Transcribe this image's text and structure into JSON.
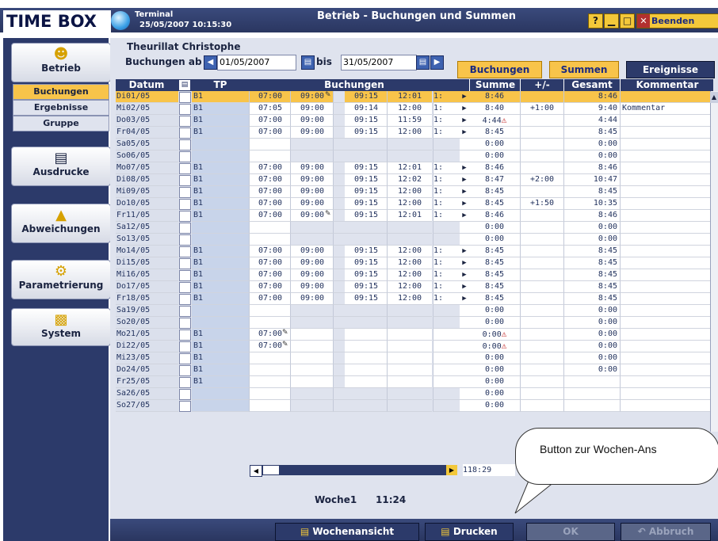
{
  "header": {
    "logo": "TIME BOX",
    "terminal_label": "Terminal",
    "terminal_datetime": "25/05/2007 10:15:30",
    "window_title": "Betrieb - Buchungen und Summen",
    "help_glyph": "?",
    "minimize_glyph": "▁",
    "maximize_glyph": "□",
    "close_glyph": "✕",
    "exit_label": "Beenden"
  },
  "sidebar": {
    "betrieb": {
      "label": "Betrieb",
      "icon": "people-icon"
    },
    "sub_items": [
      "Buchungen",
      "Ergebnisse",
      "Gruppe"
    ],
    "ausdrucke": {
      "label": "Ausdrucke",
      "icon": "document-icon"
    },
    "abweichungen": {
      "label": "Abweichungen",
      "icon": "warning-icon"
    },
    "parametrierung": {
      "label": "Parametrierung",
      "icon": "gear-icon"
    },
    "system": {
      "label": "System",
      "icon": "folder-icon"
    }
  },
  "filter": {
    "person": "Theurillat Christophe",
    "from_label": "Buchungen ab",
    "from_date": "01/05/2007",
    "to_label": "bis",
    "to_date": "31/05/2007"
  },
  "tabs": [
    "Buchungen",
    "Summen",
    "Ereignisse"
  ],
  "grid": {
    "headers": {
      "datum": "Datum",
      "tp": "TP",
      "buchungen": "Buchungen",
      "summe": "Summe",
      "plusminus": "+/-",
      "gesamt": "Gesamt",
      "kommentar": "Kommentar"
    },
    "rows": [
      {
        "d": "Di01/05",
        "tp": "B1",
        "t": [
          "07:00",
          "09:00",
          "09:15",
          "12:01",
          "1:"
        ],
        "sum": "8:46",
        "pm": "",
        "ges": "8:46",
        "kom": "",
        "sel": true
      },
      {
        "d": "Mi02/05",
        "tp": "B1",
        "t": [
          "07:05",
          "09:00",
          "09:14",
          "12:00",
          "1:"
        ],
        "sum": "8:40",
        "pm": "+1:00",
        "ges": "9:40",
        "kom": "Kommentar"
      },
      {
        "d": "Do03/05",
        "tp": "B1",
        "t": [
          "07:00",
          "09:00",
          "09:15",
          "11:59",
          "1:"
        ],
        "sum": "4:44",
        "warn": true,
        "pm": "",
        "ges": "4:44",
        "kom": ""
      },
      {
        "d": "Fr04/05",
        "tp": "B1",
        "t": [
          "07:00",
          "09:00",
          "09:15",
          "12:00",
          "1:"
        ],
        "sum": "8:45",
        "pm": "",
        "ges": "8:45",
        "kom": ""
      },
      {
        "d": "Sa05/05",
        "tp": "",
        "t": [
          "",
          "",
          "",
          "",
          ""
        ],
        "sum": "0:00",
        "pm": "",
        "ges": "0:00",
        "kom": ""
      },
      {
        "d": "So06/05",
        "tp": "",
        "t": [
          "",
          "",
          "",
          "",
          ""
        ],
        "sum": "0:00",
        "pm": "",
        "ges": "0:00",
        "kom": ""
      },
      {
        "d": "Mo07/05",
        "tp": "B1",
        "t": [
          "07:00",
          "09:00",
          "09:15",
          "12:01",
          "1:"
        ],
        "sum": "8:46",
        "pm": "",
        "ges": "8:46",
        "kom": ""
      },
      {
        "d": "Di08/05",
        "tp": "B1",
        "t": [
          "07:00",
          "09:00",
          "09:15",
          "12:02",
          "1:"
        ],
        "sum": "8:47",
        "pm": "+2:00",
        "ges": "10:47",
        "kom": ""
      },
      {
        "d": "Mi09/05",
        "tp": "B1",
        "t": [
          "07:00",
          "09:00",
          "09:15",
          "12:00",
          "1:"
        ],
        "sum": "8:45",
        "pm": "",
        "ges": "8:45",
        "kom": ""
      },
      {
        "d": "Do10/05",
        "tp": "B1",
        "t": [
          "07:00",
          "09:00",
          "09:15",
          "12:00",
          "1:"
        ],
        "sum": "8:45",
        "pm": "+1:50",
        "ges": "10:35",
        "kom": ""
      },
      {
        "d": "Fr11/05",
        "tp": "B1",
        "t": [
          "07:00",
          "09:00",
          "09:15",
          "12:01",
          "1:"
        ],
        "sum": "8:46",
        "pm": "",
        "ges": "8:46",
        "kom": ""
      },
      {
        "d": "Sa12/05",
        "tp": "",
        "t": [
          "",
          "",
          "",
          "",
          ""
        ],
        "sum": "0:00",
        "pm": "",
        "ges": "0:00",
        "kom": ""
      },
      {
        "d": "So13/05",
        "tp": "",
        "t": [
          "",
          "",
          "",
          "",
          ""
        ],
        "sum": "0:00",
        "pm": "",
        "ges": "0:00",
        "kom": ""
      },
      {
        "d": "Mo14/05",
        "tp": "B1",
        "t": [
          "07:00",
          "09:00",
          "09:15",
          "12:00",
          "1:"
        ],
        "sum": "8:45",
        "pm": "",
        "ges": "8:45",
        "kom": ""
      },
      {
        "d": "Di15/05",
        "tp": "B1",
        "t": [
          "07:00",
          "09:00",
          "09:15",
          "12:00",
          "1:"
        ],
        "sum": "8:45",
        "pm": "",
        "ges": "8:45",
        "kom": ""
      },
      {
        "d": "Mi16/05",
        "tp": "B1",
        "t": [
          "07:00",
          "09:00",
          "09:15",
          "12:00",
          "1:"
        ],
        "sum": "8:45",
        "pm": "",
        "ges": "8:45",
        "kom": ""
      },
      {
        "d": "Do17/05",
        "tp": "B1",
        "t": [
          "07:00",
          "09:00",
          "09:15",
          "12:00",
          "1:"
        ],
        "sum": "8:45",
        "pm": "",
        "ges": "8:45",
        "kom": ""
      },
      {
        "d": "Fr18/05",
        "tp": "B1",
        "t": [
          "07:00",
          "09:00",
          "09:15",
          "12:00",
          "1:"
        ],
        "sum": "8:45",
        "pm": "",
        "ges": "8:45",
        "kom": ""
      },
      {
        "d": "Sa19/05",
        "tp": "",
        "t": [
          "",
          "",
          "",
          "",
          ""
        ],
        "sum": "0:00",
        "pm": "",
        "ges": "0:00",
        "kom": ""
      },
      {
        "d": "So20/05",
        "tp": "",
        "t": [
          "",
          "",
          "",
          "",
          ""
        ],
        "sum": "0:00",
        "pm": "",
        "ges": "0:00",
        "kom": ""
      },
      {
        "d": "Mo21/05",
        "tp": "B1",
        "t": [
          "07:00",
          "",
          "",
          "",
          ""
        ],
        "sum": "0:00",
        "warn": true,
        "pm": "",
        "ges": "0:00",
        "kom": ""
      },
      {
        "d": "Di22/05",
        "tp": "B1",
        "t": [
          "07:00",
          "",
          "",
          "",
          ""
        ],
        "sum": "0:00",
        "warn": true,
        "pm": "",
        "ges": "0:00",
        "kom": ""
      },
      {
        "d": "Mi23/05",
        "tp": "B1",
        "t": [
          "",
          "",
          "",
          "",
          ""
        ],
        "sum": "0:00",
        "pm": "",
        "ges": "0:00",
        "kom": ""
      },
      {
        "d": "Do24/05",
        "tp": "B1",
        "t": [
          "",
          "",
          "",
          "",
          ""
        ],
        "sum": "0:00",
        "pm": "",
        "ges": "0:00",
        "kom": ""
      },
      {
        "d": "Fr25/05",
        "tp": "B1",
        "t": [
          "",
          "",
          "",
          "",
          ""
        ],
        "sum": "0:00",
        "pm": "",
        "ges": "",
        "kom": ""
      },
      {
        "d": "Sa26/05",
        "tp": "",
        "t": [
          "",
          "",
          "",
          "",
          ""
        ],
        "sum": "0:00",
        "pm": "",
        "ges": "",
        "kom": ""
      },
      {
        "d": "So27/05",
        "tp": "",
        "t": [
          "",
          "",
          "",
          "",
          ""
        ],
        "sum": "0:00",
        "pm": "",
        "ges": "",
        "kom": ""
      }
    ],
    "total_sum": "118:29"
  },
  "week": {
    "label": "Woche1",
    "value": "11:24"
  },
  "buttons": {
    "wochenansicht": "Wochenansicht",
    "drucken": "Drucken",
    "ok": "OK",
    "abbruch": "Abbruch"
  },
  "callout": {
    "text": "Button zur Wochen-Ans"
  },
  "colors": {
    "accent": "#f8c44a",
    "dark": "#2c3a6a"
  }
}
